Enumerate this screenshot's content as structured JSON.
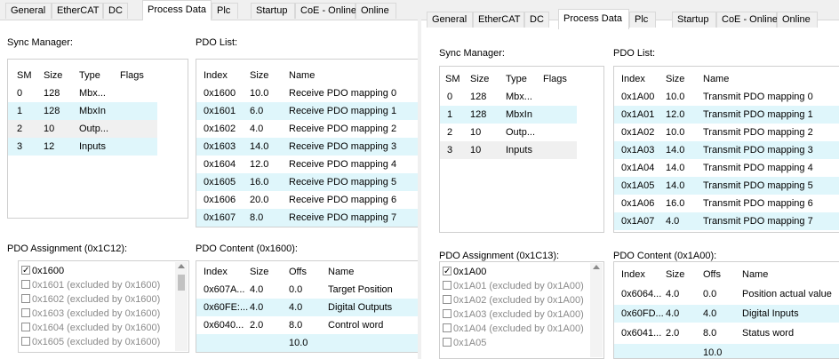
{
  "left": {
    "tabs": [
      "General",
      "EtherCAT",
      "DC",
      "Process Data",
      "Plc",
      "Startup",
      "CoE - Online",
      "Online"
    ],
    "sync_manager": {
      "label": "Sync Manager:",
      "columns": [
        "SM",
        "Size",
        "Type",
        "Flags"
      ],
      "rows": [
        [
          "0",
          "128",
          "Mbx...",
          ""
        ],
        [
          "1",
          "128",
          "MbxIn",
          ""
        ],
        [
          "2",
          "10",
          "Outp...",
          ""
        ],
        [
          "3",
          "12",
          "Inputs",
          ""
        ]
      ]
    },
    "pdo_list": {
      "label": "PDO List:",
      "columns": [
        "Index",
        "Size",
        "Name"
      ],
      "rows": [
        [
          "0x1600",
          "10.0",
          "Receive PDO mapping 0"
        ],
        [
          "0x1601",
          "6.0",
          "Receive PDO mapping 1"
        ],
        [
          "0x1602",
          "4.0",
          "Receive PDO mapping 2"
        ],
        [
          "0x1603",
          "14.0",
          "Receive PDO mapping 3"
        ],
        [
          "0x1604",
          "12.0",
          "Receive PDO mapping 4"
        ],
        [
          "0x1605",
          "16.0",
          "Receive PDO mapping 5"
        ],
        [
          "0x1606",
          "20.0",
          "Receive PDO mapping 6"
        ],
        [
          "0x1607",
          "8.0",
          "Receive PDO mapping 7"
        ]
      ]
    },
    "pdo_assignment": {
      "label": "PDO Assignment (0x1C12):",
      "items": [
        {
          "text": "0x1600",
          "checked": true
        },
        {
          "text": "0x1601 (excluded by 0x1600)",
          "checked": false
        },
        {
          "text": "0x1602 (excluded by 0x1600)",
          "checked": false
        },
        {
          "text": "0x1603 (excluded by 0x1600)",
          "checked": false
        },
        {
          "text": "0x1604 (excluded by 0x1600)",
          "checked": false
        },
        {
          "text": "0x1605 (excluded by 0x1600)",
          "checked": false
        }
      ]
    },
    "pdo_content": {
      "label": "PDO Content (0x1600):",
      "columns": [
        "Index",
        "Size",
        "Offs",
        "Name"
      ],
      "rows": [
        [
          "0x607A...",
          "4.0",
          "0.0",
          "Target Position"
        ],
        [
          "0x60FE:...",
          "4.0",
          "4.0",
          "Digital Outputs"
        ],
        [
          "0x6040...",
          "2.0",
          "8.0",
          "Control word"
        ],
        [
          "",
          "",
          "10.0",
          ""
        ]
      ]
    }
  },
  "right": {
    "tabs": [
      "General",
      "EtherCAT",
      "DC",
      "Process Data",
      "Plc",
      "Startup",
      "CoE - Online",
      "Online"
    ],
    "sync_manager": {
      "label": "Sync Manager:",
      "columns": [
        "SM",
        "Size",
        "Type",
        "Flags"
      ],
      "rows": [
        [
          "0",
          "128",
          "Mbx...",
          ""
        ],
        [
          "1",
          "128",
          "MbxIn",
          ""
        ],
        [
          "2",
          "10",
          "Outp...",
          ""
        ],
        [
          "3",
          "10",
          "Inputs",
          ""
        ]
      ]
    },
    "pdo_list": {
      "label": "PDO List:",
      "columns": [
        "Index",
        "Size",
        "Name"
      ],
      "rows": [
        [
          "0x1A00",
          "10.0",
          "Transmit PDO mapping 0"
        ],
        [
          "0x1A01",
          "12.0",
          "Transmit PDO mapping 1"
        ],
        [
          "0x1A02",
          "10.0",
          "Transmit PDO mapping 2"
        ],
        [
          "0x1A03",
          "14.0",
          "Transmit PDO mapping 3"
        ],
        [
          "0x1A04",
          "14.0",
          "Transmit PDO mapping 4"
        ],
        [
          "0x1A05",
          "14.0",
          "Transmit PDO mapping 5"
        ],
        [
          "0x1A06",
          "16.0",
          "Transmit PDO mapping 6"
        ],
        [
          "0x1A07",
          "4.0",
          "Transmit PDO mapping 7"
        ]
      ]
    },
    "pdo_assignment": {
      "label": "PDO Assignment (0x1C13):",
      "items": [
        {
          "text": "0x1A00",
          "checked": true
        },
        {
          "text": "0x1A01 (excluded by 0x1A00)",
          "checked": false
        },
        {
          "text": "0x1A02 (excluded by 0x1A00)",
          "checked": false
        },
        {
          "text": "0x1A03 (excluded by 0x1A00)",
          "checked": false
        },
        {
          "text": "0x1A04 (excluded by 0x1A00)",
          "checked": false
        },
        {
          "text": "0x1A05",
          "checked": false
        }
      ]
    },
    "pdo_content": {
      "label": "PDO Content (0x1A00):",
      "columns": [
        "Index",
        "Size",
        "Offs",
        "Name"
      ],
      "rows": [
        [
          "0x6064...",
          "4.0",
          "0.0",
          "Position actual value"
        ],
        [
          "0x60FD...",
          "4.0",
          "4.0",
          "Digital Inputs"
        ],
        [
          "0x6041...",
          "2.0",
          "8.0",
          "Status word"
        ],
        [
          "",
          "",
          "10.0",
          ""
        ]
      ]
    }
  },
  "colors": {
    "row_alt": "#dff6fb",
    "border": "#cfcfcf",
    "tab_bg": "#f0f0f0"
  }
}
